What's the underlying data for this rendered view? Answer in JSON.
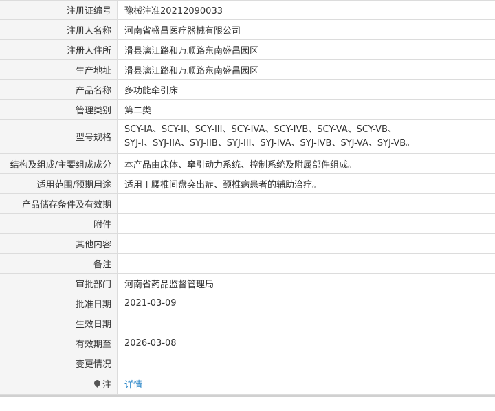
{
  "rows": [
    {
      "label": "注册证编号",
      "value": "豫械注准20212090033"
    },
    {
      "label": "注册人名称",
      "value": "河南省盛昌医疗器械有限公司"
    },
    {
      "label": "注册人住所",
      "value": "滑县漓江路和万顺路东南盛昌园区"
    },
    {
      "label": "生产地址",
      "value": "滑县漓江路和万顺路东南盛昌园区"
    },
    {
      "label": "产品名称",
      "value": "多功能牵引床"
    },
    {
      "label": "管理类别",
      "value": "第二类"
    },
    {
      "label": "型号规格",
      "value_line1": "SCY-IA、SCY-II、SCY-III、SCY-IVA、SCY-IVB、SCY-VA、SCY-VB、",
      "value_line2": "SYJ-I、SYJ-IIA、SYJ-IIB、SYJ-III、SYJ-IVA、SYJ-IVB、SYJ-VA、SYJ-VB。"
    },
    {
      "label": "结构及组成/主要组成成分",
      "value": "本产品由床体、牵引动力系统、控制系统及附属部件组成。"
    },
    {
      "label": "适用范围/预期用途",
      "value": "适用于腰椎间盘突出症、颈椎病患者的辅助治疗。"
    },
    {
      "label": "产品储存条件及有效期",
      "value": ""
    },
    {
      "label": "附件",
      "value": ""
    },
    {
      "label": "其他内容",
      "value": ""
    },
    {
      "label": "备注",
      "value": ""
    },
    {
      "label": "审批部门",
      "value": "河南省药品监督管理局"
    },
    {
      "label": "批准日期",
      "value": "2021-03-09"
    },
    {
      "label": "生效日期",
      "value": ""
    },
    {
      "label": "有效期至",
      "value": "2026-03-08"
    },
    {
      "label": "变更情况",
      "value": ""
    }
  ],
  "note": {
    "label": "注",
    "icon": "pin-icon",
    "link_text": "详情"
  },
  "colors": {
    "label_bg": "#f5f5f5",
    "border": "#dcdcdc",
    "link": "#2a86c8",
    "text": "#333333"
  }
}
